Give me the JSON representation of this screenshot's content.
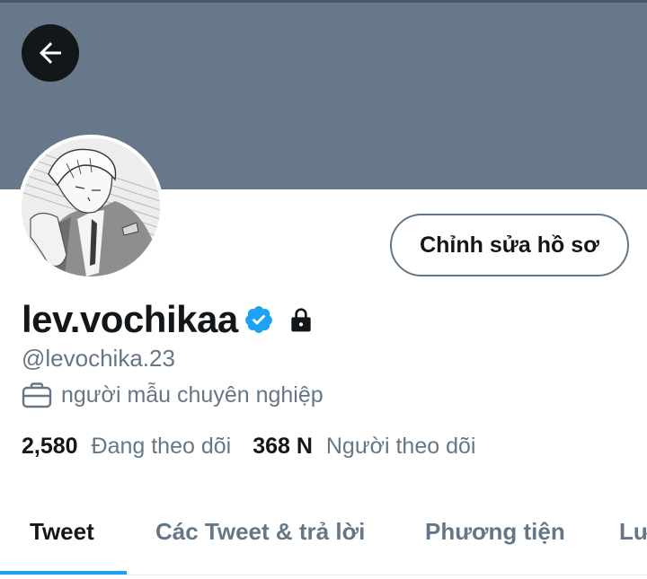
{
  "profile": {
    "display_name": "lev.vochikaa",
    "handle": "@levochika.23",
    "bio": "người mẫu chuyên nghiệp",
    "verified": true,
    "protected": true,
    "edit_button_label": "Chỉnh sửa hồ sơ"
  },
  "stats": {
    "following_count": "2,580",
    "following_label": "Đang theo dõi",
    "followers_count": "368 N",
    "followers_label": "Người theo dõi"
  },
  "tabs": [
    {
      "label": "Tweet",
      "active": true
    },
    {
      "label": "Các Tweet & trả lời",
      "active": false
    },
    {
      "label": "Phương tiện",
      "active": false
    },
    {
      "label": "Lư",
      "active": false
    }
  ],
  "colors": {
    "banner": "#66788a",
    "accent": "#1da1f2",
    "secondary_text": "#657786"
  },
  "icons": {
    "back": "arrow-left-icon",
    "verified": "verified-badge-icon",
    "lock": "lock-icon",
    "bio": "briefcase-icon"
  }
}
